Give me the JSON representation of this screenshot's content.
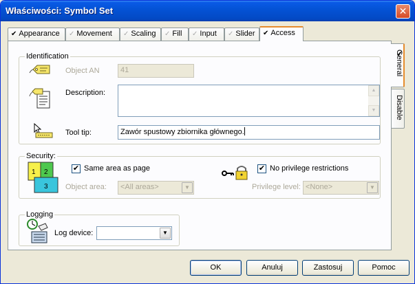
{
  "window": {
    "title": "Właściwości: Symbol Set",
    "close_glyph": "✕"
  },
  "tabs": [
    {
      "label": "Appearance",
      "checked": true
    },
    {
      "label": "Movement",
      "checked": false
    },
    {
      "label": "Scaling",
      "checked": false
    },
    {
      "label": "Fill",
      "checked": false
    },
    {
      "label": "Input",
      "checked": false
    },
    {
      "label": "Slider",
      "checked": false
    },
    {
      "label": "Access",
      "checked": true,
      "active": true
    }
  ],
  "side_tabs": [
    {
      "label": "General",
      "checked": true,
      "active": true
    },
    {
      "label": "Disable",
      "checked": false
    }
  ],
  "identification": {
    "group_label": "Identification",
    "object_an_label": "Object AN",
    "object_an_value": "41",
    "description_label": "Description:",
    "description_value": "",
    "tooltip_label": "Tool tip:",
    "tooltip_value": "Zawór spustowy zbiornika głównego."
  },
  "security": {
    "group_label": "Security:",
    "same_area_label": "Same area as page",
    "same_area_checked": true,
    "object_area_label": "Object area:",
    "object_area_value": "<All areas>",
    "no_privilege_label": "No privilege restrictions",
    "no_privilege_checked": true,
    "privilege_level_label": "Privilege level:",
    "privilege_level_value": "<None>",
    "area_icon_numbers": [
      "1",
      "2",
      "3"
    ]
  },
  "logging": {
    "group_label": "Logging",
    "log_device_label": "Log device:",
    "log_device_value": ""
  },
  "buttons": {
    "ok": "OK",
    "cancel": "Anuluj",
    "apply": "Zastosuj",
    "help": "Pomoc"
  }
}
